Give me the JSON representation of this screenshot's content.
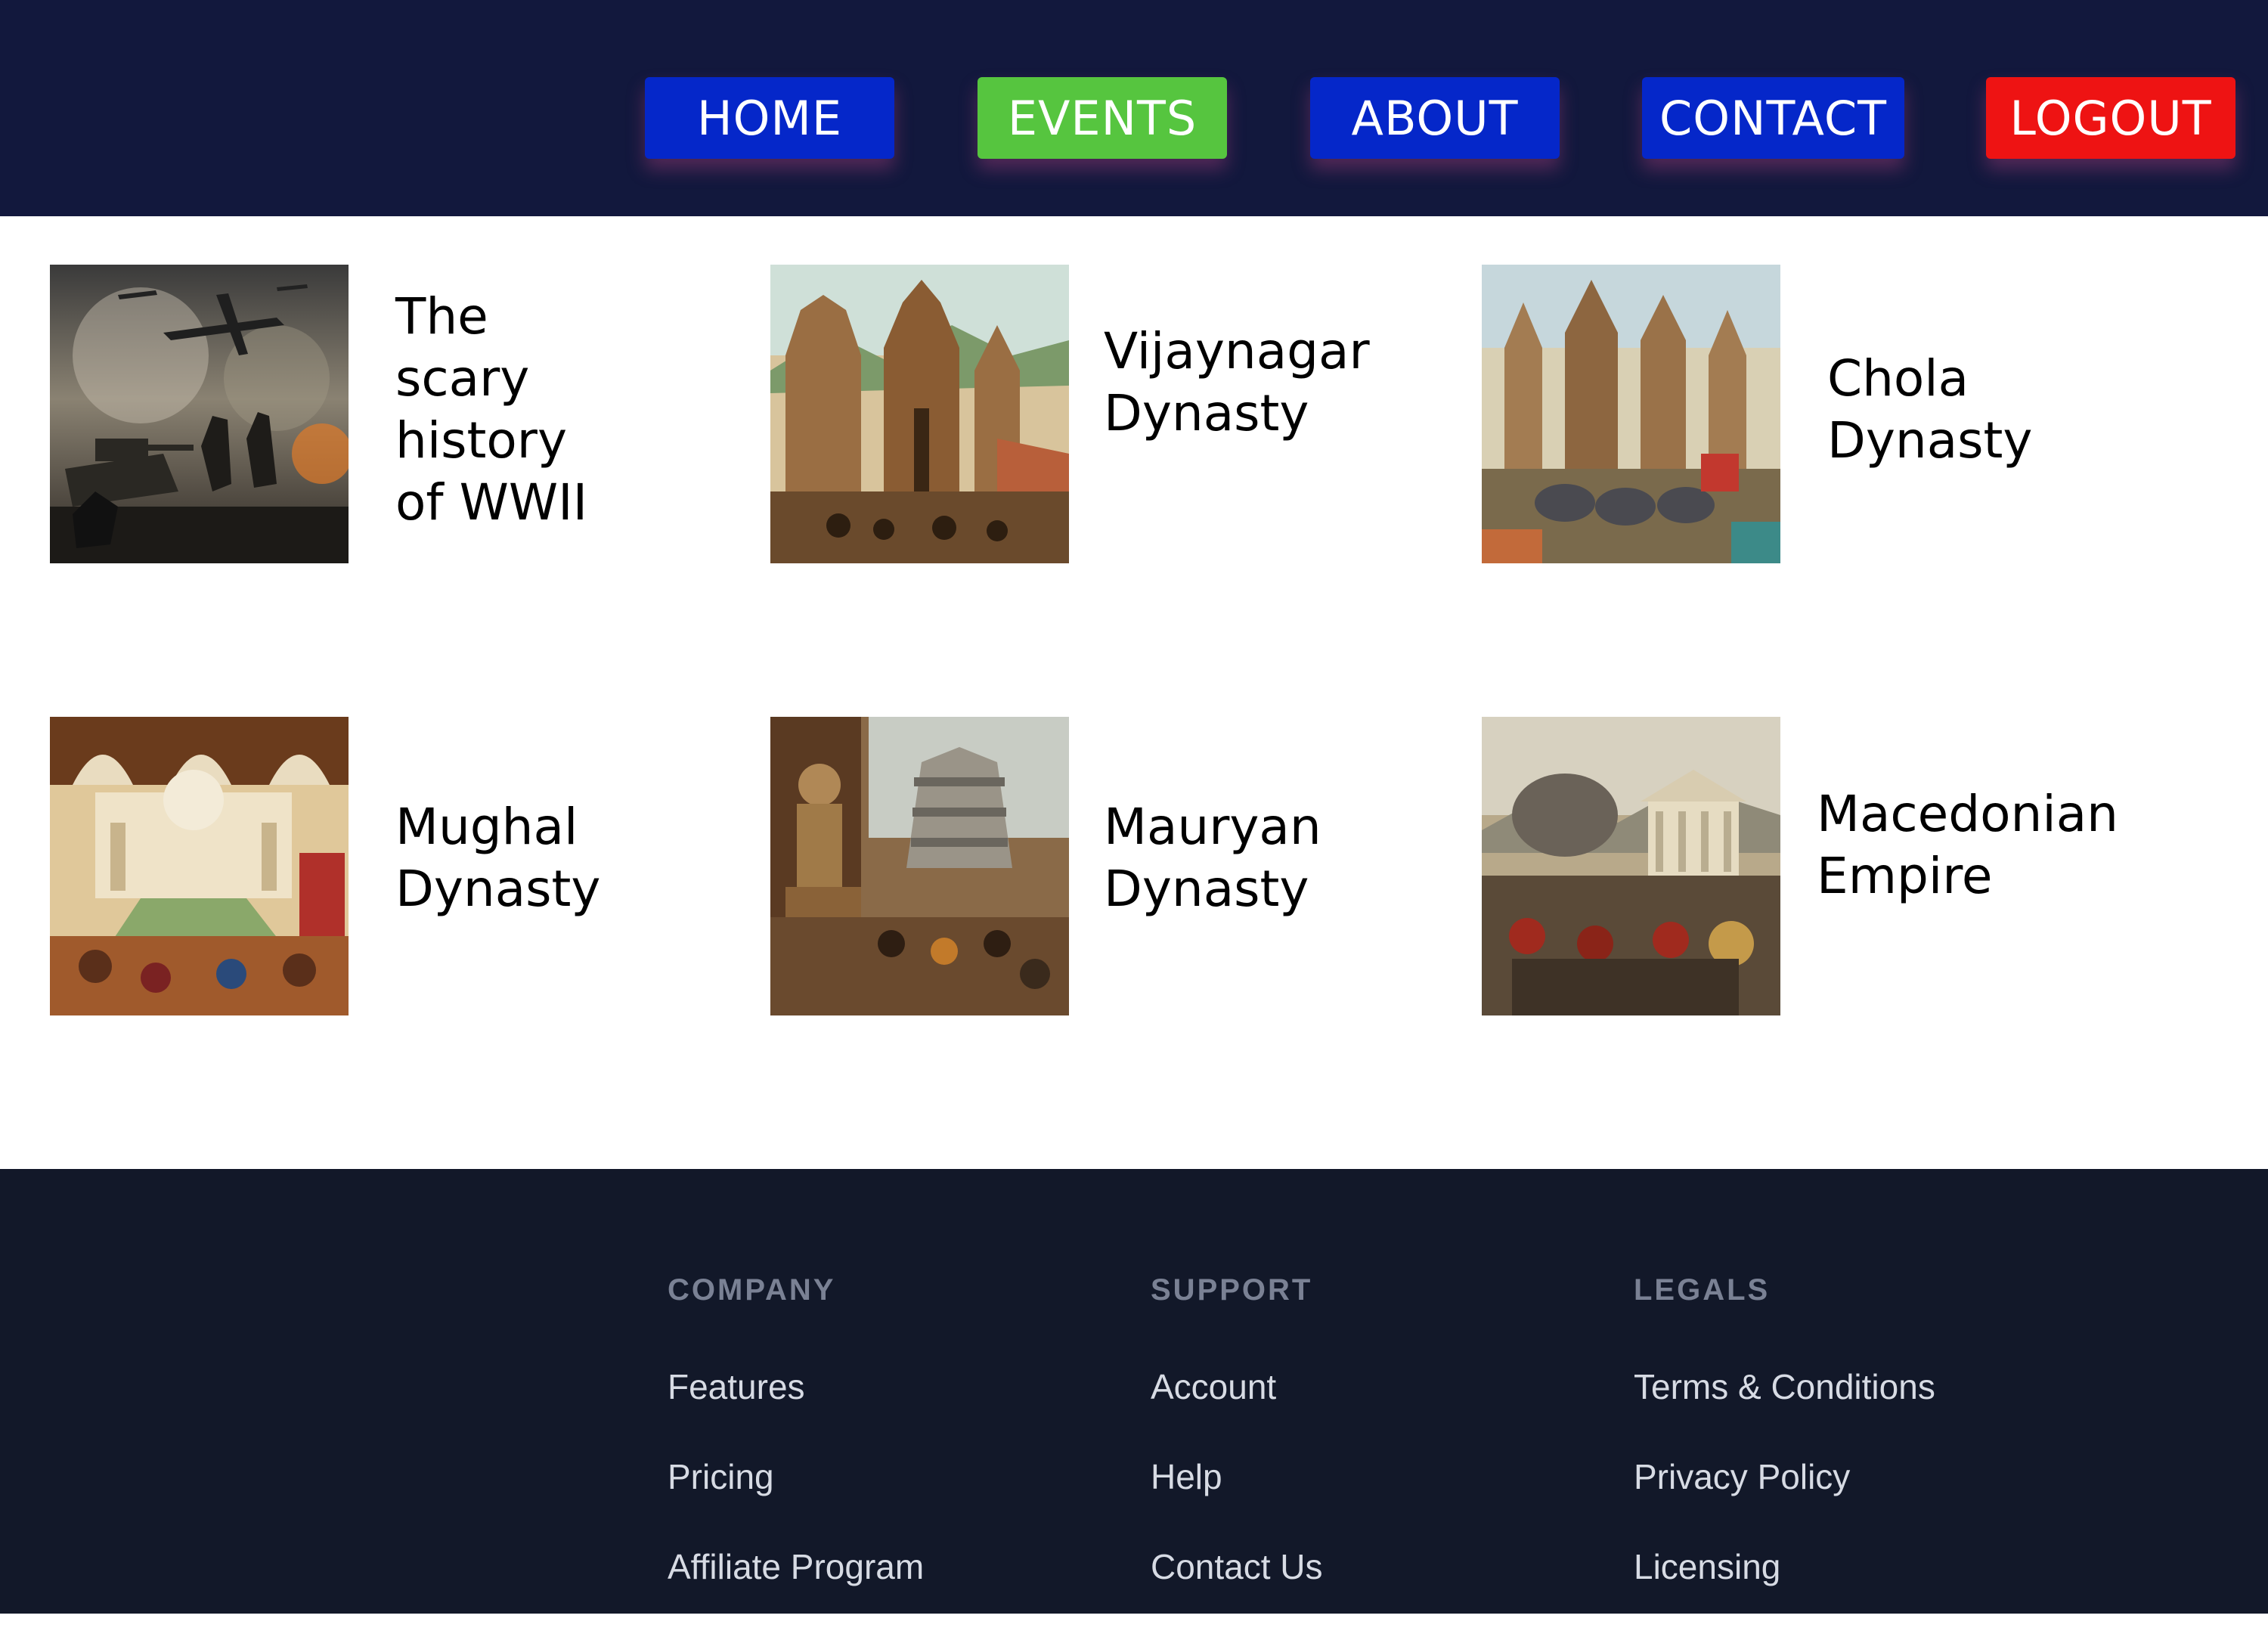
{
  "nav": {
    "items": [
      {
        "label": "HOME",
        "color": "#0527c9"
      },
      {
        "label": "EVENTS",
        "color": "#56c53f"
      },
      {
        "label": "ABOUT",
        "color": "#0527c9"
      },
      {
        "label": "CONTACT",
        "color": "#0527c9"
      },
      {
        "label": "LOGOUT",
        "color": "#ee1313"
      }
    ],
    "header_bg": "#12183d"
  },
  "events": [
    {
      "title": "The\nscary\nhistory\nof WWII",
      "image": "ww2-battle-image"
    },
    {
      "title": "Vijaynagar\nDynasty",
      "image": "vijaynagar-temple-image"
    },
    {
      "title": "Chola\nDynasty",
      "image": "chola-temple-image"
    },
    {
      "title": "Mughal\nDynasty",
      "image": "mughal-palace-image"
    },
    {
      "title": "Mauryan\nDynasty",
      "image": "mauryan-stupa-image"
    },
    {
      "title": "Macedonian\nEmpire",
      "image": "macedonian-battle-image"
    }
  ],
  "footer": {
    "bg": "#121829",
    "columns": [
      {
        "heading": "COMPANY",
        "links": [
          "Features",
          "Pricing",
          "Affiliate Program"
        ]
      },
      {
        "heading": "SUPPORT",
        "links": [
          "Account",
          "Help",
          "Contact Us"
        ]
      },
      {
        "heading": "LEGALS",
        "links": [
          "Terms & Conditions",
          "Privacy Policy",
          "Licensing"
        ]
      }
    ]
  }
}
